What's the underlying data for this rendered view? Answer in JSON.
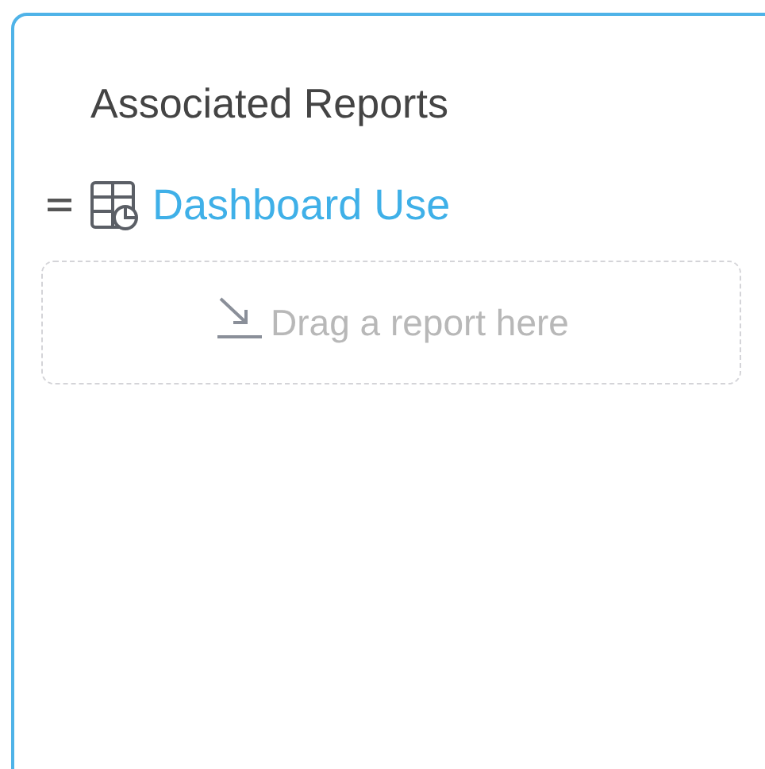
{
  "panel": {
    "title": "Associated Reports",
    "reports": [
      {
        "label": "Dashboard Use"
      }
    ],
    "drop_zone": {
      "text": "Drag a report here"
    }
  }
}
